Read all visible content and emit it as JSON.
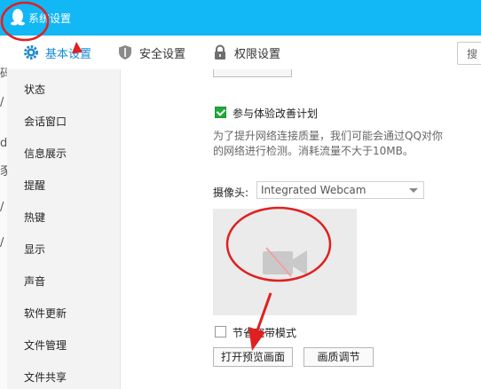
{
  "window": {
    "title": "系统设置",
    "title_icon": "qq-penguin-icon"
  },
  "tabs": [
    {
      "label": "基本设置",
      "icon": "gear-icon",
      "active": true
    },
    {
      "label": "安全设置",
      "icon": "shield-icon",
      "active": false
    },
    {
      "label": "权限设置",
      "icon": "lock-icon",
      "active": false
    }
  ],
  "search": {
    "visible_text": "搜"
  },
  "left_strip_glyphs": [
    "码",
    "/",
    "d",
    "豕",
    "/",
    "/"
  ],
  "sidebar": {
    "items": [
      {
        "label": "状态"
      },
      {
        "label": "会话窗口"
      },
      {
        "label": "信息展示"
      },
      {
        "label": "提醒"
      },
      {
        "label": "热键"
      },
      {
        "label": "显示"
      },
      {
        "label": "声音"
      },
      {
        "label": "软件更新"
      },
      {
        "label": "文件管理"
      },
      {
        "label": "文件共享"
      }
    ]
  },
  "content": {
    "experience_program": {
      "label": "参与体验改善计划",
      "checked": true,
      "description": "为了提升网络连接质量，我们可能会通过QQ对你的网络进行检测。消耗流量不大于10MB。"
    },
    "camera": {
      "label": "摄像头:",
      "selected": "Integrated Webcam",
      "preview_icon": "camera-off-icon"
    },
    "save_mode": {
      "label": "节省宽带模式",
      "checked": false
    },
    "buttons": {
      "open_preview": "打开预览画面",
      "quality_adjust": "画质调节"
    }
  },
  "colors": {
    "titlebar": "#12b7f5",
    "accent": "#1a8ad6",
    "checkbox_checked": "#21a83b",
    "annotation": "#e02020"
  }
}
